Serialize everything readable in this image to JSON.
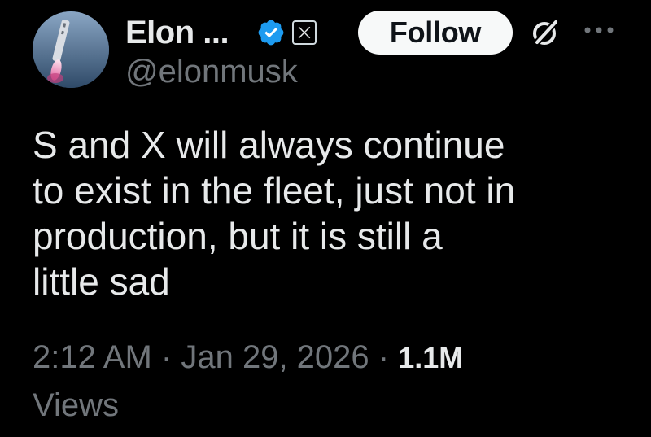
{
  "author": {
    "display_name": "Elon ...",
    "handle": "@elonmusk",
    "verified_icon": "verified-badge-icon",
    "affiliate_icon": "x-logo-icon"
  },
  "actions": {
    "follow_label": "Follow",
    "grok_icon": "grok-icon",
    "more_icon": "more-options-icon"
  },
  "tweet": {
    "text": "S and X will always continue\nto exist in the fleet, just not in\nproduction, but it is still a\nlittle sad",
    "time": "2:12 AM",
    "separator": "·",
    "date": "Jan 29, 2026",
    "views_count": "1.1M",
    "views_label": "Views"
  },
  "colors": {
    "background": "#000000",
    "text_primary": "#e7e9ea",
    "text_secondary": "#71767b",
    "verified_blue": "#1d9bf0",
    "follow_bg": "#f7f9f9"
  }
}
